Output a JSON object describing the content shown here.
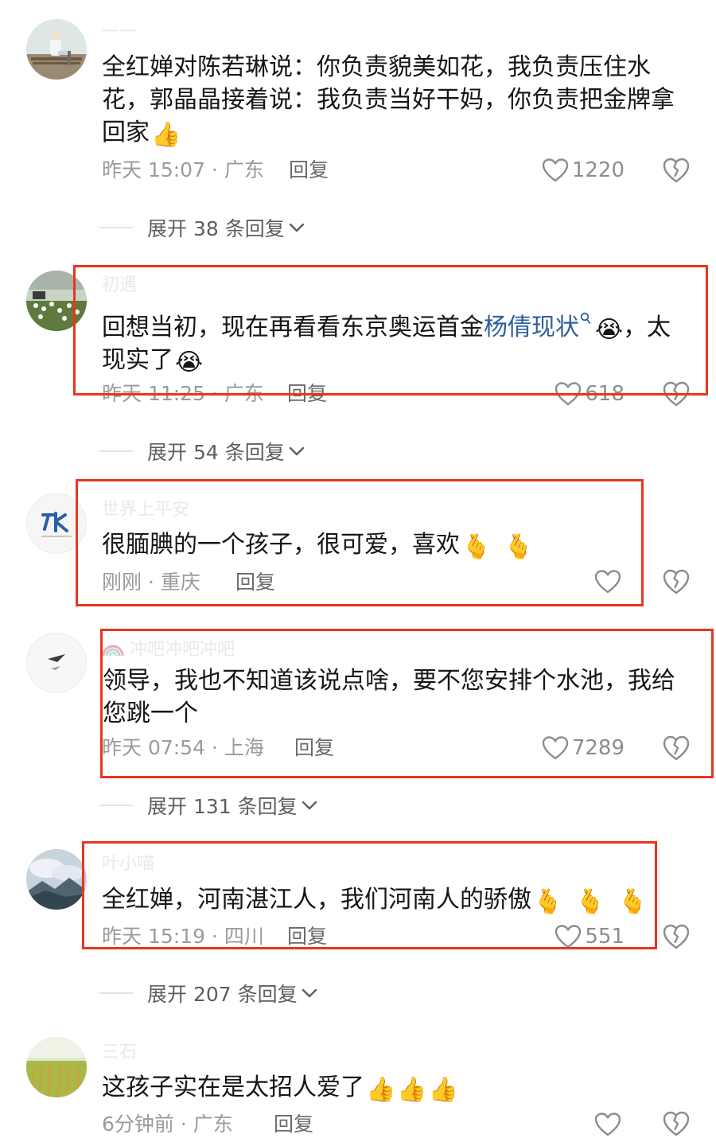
{
  "colors": {
    "highlight_link": "#2f5f9e",
    "annotation_red": "#e8361f",
    "meta_gray": "#9b9b9b"
  },
  "comments": [
    {
      "username": "一一",
      "text": "全红婵对陈若琳说：你负责貌美如花，我负责压住水花，郭晶晶接着说：我负责当好干妈，你负责把金牌拿回家",
      "emojis": [
        "👍"
      ],
      "time": "昨天 15:07",
      "location": "广东",
      "reply_label": "回复",
      "likes": "1220",
      "expand_label": "展开 38 条回复"
    },
    {
      "username": "初遇",
      "text_before": "回想当初，现在再看看东京奥运首金",
      "link_text": "杨倩现状",
      "search_icon": "search-icon",
      "emoji_after_link": "😭",
      "text_after": "，太现实了",
      "emojis": [
        "😭"
      ],
      "time": "昨天 11:25",
      "location": "广东",
      "reply_label": "回复",
      "likes": "618",
      "expand_label": "展开 54 条回复"
    },
    {
      "username": "世界上平安",
      "text": "很腼腆的一个孩子，很可爱，喜欢",
      "emojis": [
        "🫰",
        "🫰"
      ],
      "time": "刚刚",
      "location": "重庆",
      "reply_label": "回复",
      "likes": ""
    },
    {
      "username": "冲吧冲吧冲吧",
      "text": "领导，我也不知道该说点啥，要不您安排个水池，我给您跳一个",
      "time": "昨天 07:54",
      "location": "上海",
      "reply_label": "回复",
      "likes": "7289",
      "expand_label": "展开 131 条回复"
    },
    {
      "username": "叶小喵",
      "text": "全红婵，河南湛江人，我们河南人的骄傲",
      "emojis": [
        "🫰",
        "🫰",
        "🫰"
      ],
      "time": "昨天 15:19",
      "location": "四川",
      "reply_label": "回复",
      "likes": "551",
      "expand_label": "展开 207 条回复"
    },
    {
      "username": "三石",
      "text": "这孩子实在是太招人爱了",
      "emojis": [
        "👍",
        "👍",
        "👍"
      ],
      "time": "6分钟前",
      "location": "广东",
      "reply_label": "回复",
      "likes": ""
    }
  ]
}
